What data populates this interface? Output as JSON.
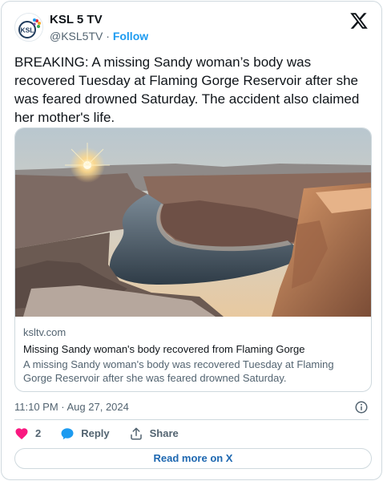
{
  "author": {
    "name": "KSL 5 TV",
    "handle": "@KSL5TV",
    "separator": "·",
    "follow_label": "Follow",
    "avatar_text": "KSL"
  },
  "tweet": {
    "text": "BREAKING: A missing Sandy woman’s body was recovered Tuesday at Flaming Gorge Reservoir after she was feared drowned Saturday. The accident also claimed her mother's life."
  },
  "link_card": {
    "domain": "ksltv.com",
    "title": "Missing Sandy woman's body recovered from Flaming Gorge",
    "description": "A missing Sandy woman's body was recovered Tuesday at Flaming Gorge Reservoir after she was feared drowned Saturday."
  },
  "meta": {
    "timestamp": "11:10 PM · Aug 27, 2024"
  },
  "actions": {
    "like_count": "2",
    "reply_label": "Reply",
    "share_label": "Share"
  },
  "read_more_label": "Read more on X",
  "colors": {
    "accent": "#1d9bf0",
    "heart": "#f91880",
    "reply": "#1d9bf0",
    "read_more": "#1d67b0"
  },
  "icons": [
    "x-logo-icon",
    "info-icon",
    "heart-icon",
    "reply-bubble-icon",
    "share-icon"
  ]
}
